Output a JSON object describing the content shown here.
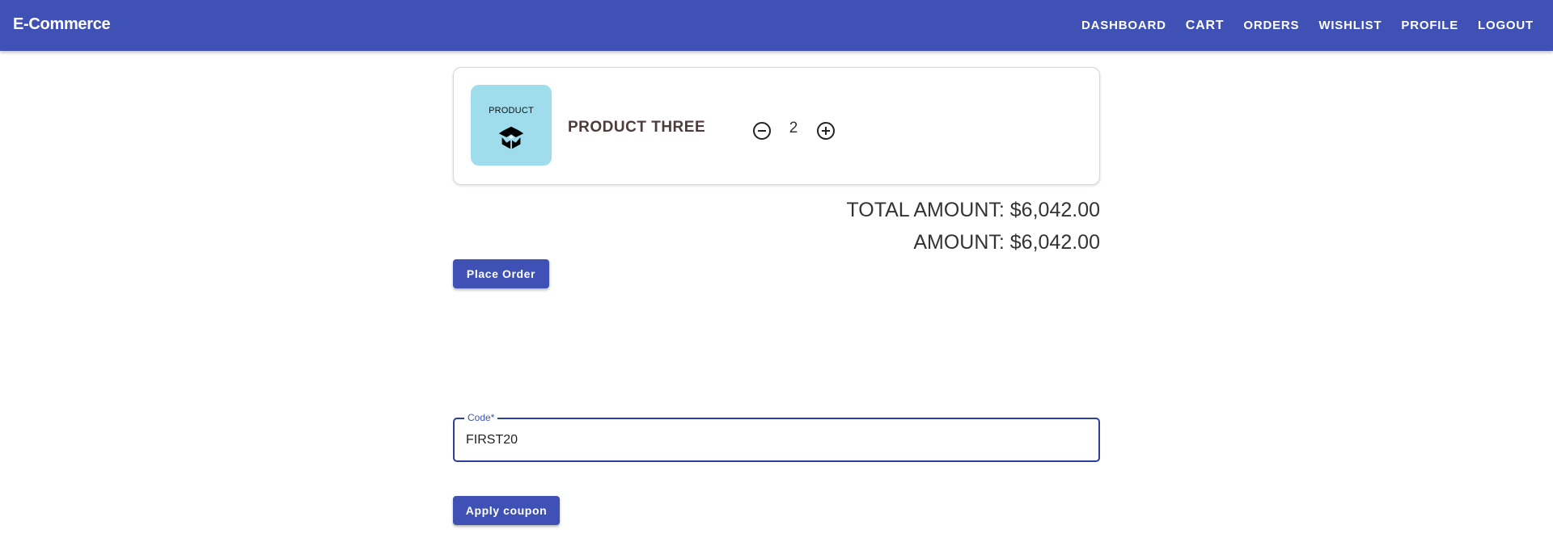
{
  "app": {
    "title": "E-Commerce"
  },
  "nav": {
    "items": [
      {
        "label": "DASHBOARD"
      },
      {
        "label": "CART"
      },
      {
        "label": "ORDERS"
      },
      {
        "label": "WISHLIST"
      },
      {
        "label": "PROFILE"
      },
      {
        "label": "LOGOUT"
      }
    ],
    "active": "CART"
  },
  "cart": {
    "item": {
      "thumb_label": "PRODUCT",
      "thumb_icon": "box-open-icon",
      "name": "PRODUCT THREE",
      "quantity": "2",
      "minus_icon": "minus-circle-icon",
      "plus_icon": "plus-circle-icon"
    }
  },
  "totals": {
    "total_amount": "TOTAL AMOUNT: $6,042.00",
    "amount": "AMOUNT: $6,042.00"
  },
  "actions": {
    "place_order_label": "Place Order",
    "apply_coupon_label": "Apply coupon"
  },
  "coupon": {
    "label": "Code*",
    "value": "FIRST20"
  },
  "colors": {
    "primary": "#3f51b5",
    "thumb_bg": "#9fdcec",
    "product_name": "#4e3b3b"
  }
}
